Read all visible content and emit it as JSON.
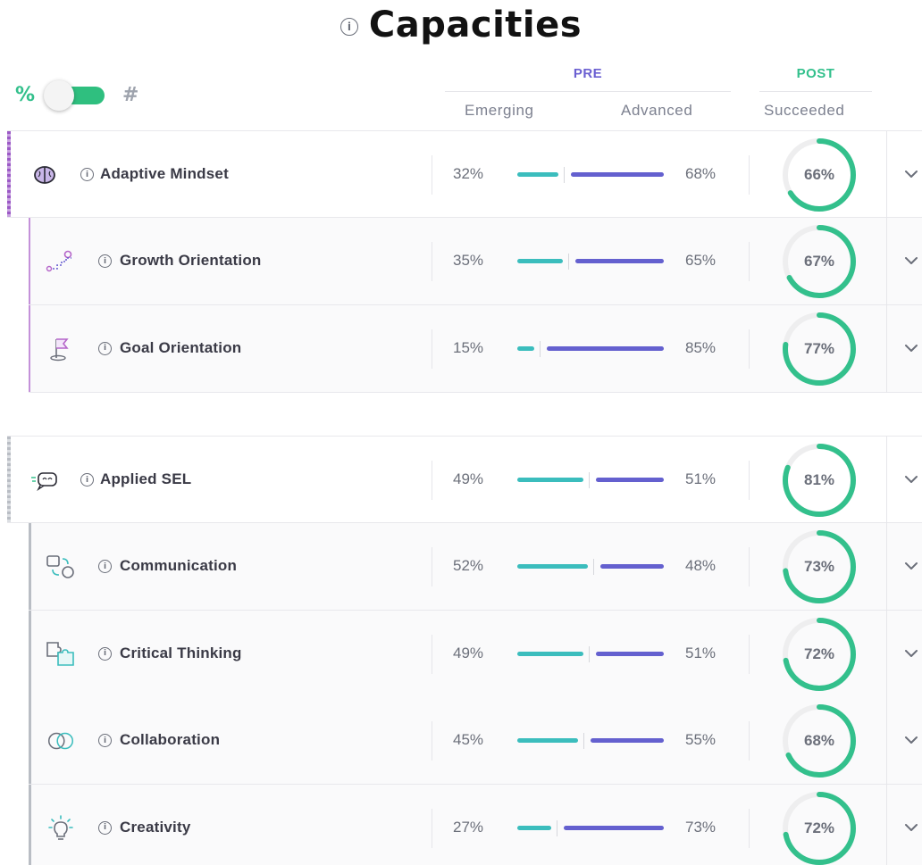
{
  "page": {
    "title": "Capacities"
  },
  "toggle": {
    "left_label": "%",
    "right_label": "#",
    "on": true
  },
  "headers": {
    "pre": "PRE",
    "post": "POST",
    "emerging": "Emerging",
    "advanced": "Advanced",
    "succeeded": "Succeeded"
  },
  "colors": {
    "emerging": "#3bbdbd",
    "advanced": "#6460cf",
    "succeeded": "#33c08c",
    "pre": "#6a5fd1"
  },
  "groups": [
    {
      "parent": {
        "name": "Adaptive Mindset",
        "icon": "brain-icon",
        "emerging": "32%",
        "advanced": "68%",
        "emerging_value": 32,
        "advanced_value": 68,
        "succeeded": "66%",
        "succeeded_value": 66
      },
      "children": [
        {
          "name": "Growth Orientation",
          "icon": "stairs-icon",
          "emerging": "35%",
          "advanced": "65%",
          "emerging_value": 35,
          "advanced_value": 65,
          "succeeded": "67%",
          "succeeded_value": 67
        },
        {
          "name": "Goal Orientation",
          "icon": "flag-icon",
          "emerging": "15%",
          "advanced": "85%",
          "emerging_value": 15,
          "advanced_value": 85,
          "succeeded": "77%",
          "succeeded_value": 77
        }
      ]
    },
    {
      "parent": {
        "name": "Applied SEL",
        "icon": "chat-bubble-icon",
        "emerging": "49%",
        "advanced": "51%",
        "emerging_value": 49,
        "advanced_value": 51,
        "succeeded": "81%",
        "succeeded_value": 81
      },
      "children": [
        {
          "name": "Communication",
          "icon": "communication-icon",
          "emerging": "52%",
          "advanced": "48%",
          "emerging_value": 52,
          "advanced_value": 48,
          "succeeded": "73%",
          "succeeded_value": 73
        },
        {
          "name": "Critical Thinking",
          "icon": "puzzle-icon",
          "emerging": "49%",
          "advanced": "51%",
          "emerging_value": 49,
          "advanced_value": 51,
          "succeeded": "72%",
          "succeeded_value": 72
        },
        {
          "name": "Collaboration",
          "icon": "overlapping-circles-icon",
          "emerging": "45%",
          "advanced": "55%",
          "emerging_value": 45,
          "advanced_value": 55,
          "succeeded": "68%",
          "succeeded_value": 68
        },
        {
          "name": "Creativity",
          "icon": "lightbulb-icon",
          "emerging": "27%",
          "advanced": "73%",
          "emerging_value": 27,
          "advanced_value": 73,
          "succeeded": "72%",
          "succeeded_value": 72
        }
      ]
    }
  ]
}
